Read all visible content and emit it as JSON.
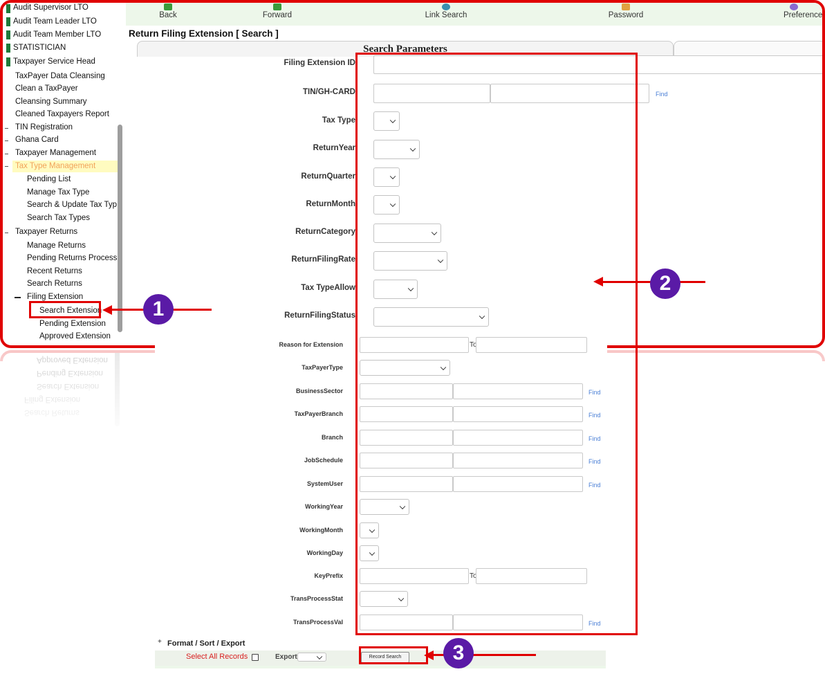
{
  "sidebar": {
    "items": [
      {
        "label": "Audit Supervisor LTO",
        "marker": "green"
      },
      {
        "label": "Audit Team Leader LTO",
        "marker": "green"
      },
      {
        "label": "Audit Team Member LTO",
        "marker": "green"
      },
      {
        "label": "STATISTICIAN",
        "marker": "green"
      },
      {
        "label": "Taxpayer Service Head",
        "marker": "green"
      },
      {
        "label": "TaxPayer Data Cleansing",
        "marker": "none"
      },
      {
        "label": "Clean a TaxPayer",
        "marker": "none"
      },
      {
        "label": "Cleansing Summary",
        "marker": "none"
      },
      {
        "label": "Cleaned Taxpayers Report",
        "marker": "none"
      },
      {
        "label": "TIN Registration",
        "marker": "dash"
      },
      {
        "label": "Ghana Card",
        "marker": "dash"
      },
      {
        "label": "Taxpayer Management",
        "marker": "dash"
      },
      {
        "label": "Tax Type Management",
        "marker": "dash"
      },
      {
        "label": "Pending  List",
        "marker": "none"
      },
      {
        "label": "Manage Tax Type",
        "marker": "none"
      },
      {
        "label": "Search & Update Tax Type",
        "marker": "none"
      },
      {
        "label": "Search Tax Types",
        "marker": "none"
      },
      {
        "label": "Taxpayer Returns",
        "marker": "dash"
      },
      {
        "label": "Manage Returns",
        "marker": "none"
      },
      {
        "label": "Pending Returns Process",
        "marker": "none"
      },
      {
        "label": "Recent Returns",
        "marker": "none"
      },
      {
        "label": "Search Returns",
        "marker": "none"
      },
      {
        "label": "Filing Extension",
        "marker": "minus"
      },
      {
        "label": "Search Extension",
        "marker": "none"
      },
      {
        "label": "Pending Extension",
        "marker": "none"
      },
      {
        "label": "Approved Extension",
        "marker": "none"
      }
    ]
  },
  "toolbar": {
    "back": "Back",
    "forward": "Forward",
    "link_search": "Link Search",
    "password": "Password",
    "preferences": "Preference"
  },
  "page_title": "Return Filing Extension [ Search ]",
  "tab_label": "Search Parameters",
  "find_label": "Find",
  "to_label": "To",
  "upper_fields": {
    "filing_extension_id": "Filing Extension ID",
    "tin": "TIN/GH-CARD",
    "tax_type": "Tax Type",
    "return_year": "ReturnYear",
    "return_quarter": "ReturnQuarter",
    "return_month": "ReturnMonth",
    "return_category": "ReturnCategory",
    "return_filing_rate": "ReturnFilingRate",
    "tax_type_allow": "Tax TypeAllow",
    "return_filing_status": "ReturnFilingStatus"
  },
  "lower_fields": {
    "reason": "Reason for Extension",
    "taxpayer_type": "TaxPayerType",
    "business_sector": "BusinessSector",
    "taxpayer_branch": "TaxPayerBranch",
    "branch": "Branch",
    "job_schedule": "JobSchedule",
    "system_user": "SystemUser",
    "working_year": "WorkingYear",
    "working_month": "WorkingMonth",
    "working_day": "WorkingDay",
    "key_prefix": "KeyPrefix",
    "trans_process_stat": "TransProcessStat",
    "trans_process_val": "TransProcessVal"
  },
  "format_bar": {
    "expander": "+",
    "title": "Format / Sort / Export",
    "select_all": "Select All Records",
    "export": "Export",
    "record_search": "Record Search"
  },
  "annotations": {
    "badge1": "1",
    "badge2": "2",
    "badge3": "3"
  },
  "colors": {
    "annotation_red": "#e00000",
    "badge_purple": "#5a1aa6",
    "toolbar_green": "#edf7ea",
    "highlight_yellow": "#fffbc0"
  }
}
